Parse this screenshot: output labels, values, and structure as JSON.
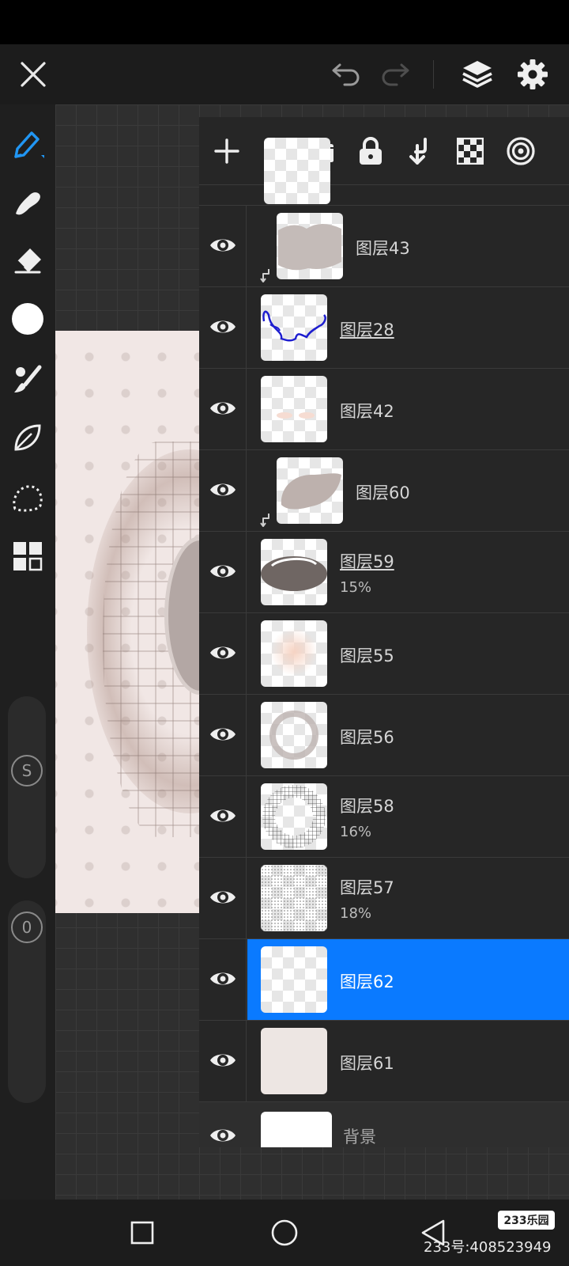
{
  "app": {
    "topbar": {
      "close_icon": "close-icon",
      "undo_icon": "undo-icon",
      "redo_icon": "redo-icon",
      "layers_icon": "layers-icon",
      "settings_icon": "gear-icon"
    },
    "colors": {
      "selected_accent": "#0a7aff",
      "panel_bg": "#262626",
      "toolbar_bg": "#1f1f1f"
    }
  },
  "toolbar": {
    "tools": [
      "pencil-icon",
      "smudge-icon",
      "eraser-icon",
      "color-swatch",
      "brush-icon",
      "lasso-fill-icon",
      "selection-icon",
      "gallery-icon"
    ],
    "size_slider_label": "S",
    "opacity_slider_label": "0"
  },
  "layers_panel": {
    "header_icons": [
      "add-icon",
      "folder-icon",
      "lock-icon",
      "clip-icon",
      "transparency-icon",
      "blend-icon"
    ],
    "layers": [
      {
        "name": "图层43",
        "opacity": "",
        "clipped": true,
        "underlined": false,
        "selected": false
      },
      {
        "name": "图层28",
        "opacity": "",
        "clipped": false,
        "underlined": true,
        "selected": false
      },
      {
        "name": "图层42",
        "opacity": "",
        "clipped": false,
        "underlined": false,
        "selected": false
      },
      {
        "name": "图层60",
        "opacity": "",
        "clipped": true,
        "underlined": false,
        "selected": false
      },
      {
        "name": "图层59",
        "opacity": "15%",
        "clipped": false,
        "underlined": true,
        "selected": false
      },
      {
        "name": "图层55",
        "opacity": "",
        "clipped": false,
        "underlined": false,
        "selected": false
      },
      {
        "name": "图层56",
        "opacity": "",
        "clipped": false,
        "underlined": false,
        "selected": false
      },
      {
        "name": "图层58",
        "opacity": "16%",
        "clipped": false,
        "underlined": false,
        "selected": false
      },
      {
        "name": "图层57",
        "opacity": "18%",
        "clipped": false,
        "underlined": false,
        "selected": false
      },
      {
        "name": "图层62",
        "opacity": "",
        "clipped": false,
        "underlined": false,
        "selected": true
      },
      {
        "name": "图层61",
        "opacity": "",
        "clipped": false,
        "underlined": false,
        "selected": false
      }
    ],
    "background_layer": {
      "name": "背景"
    }
  },
  "bottom_nav": {
    "recent_icon": "square-icon",
    "home_icon": "circle-icon",
    "back_icon": "triangle-back-icon"
  },
  "watermark": {
    "logo": "233乐园",
    "text": "233号:408523949"
  }
}
